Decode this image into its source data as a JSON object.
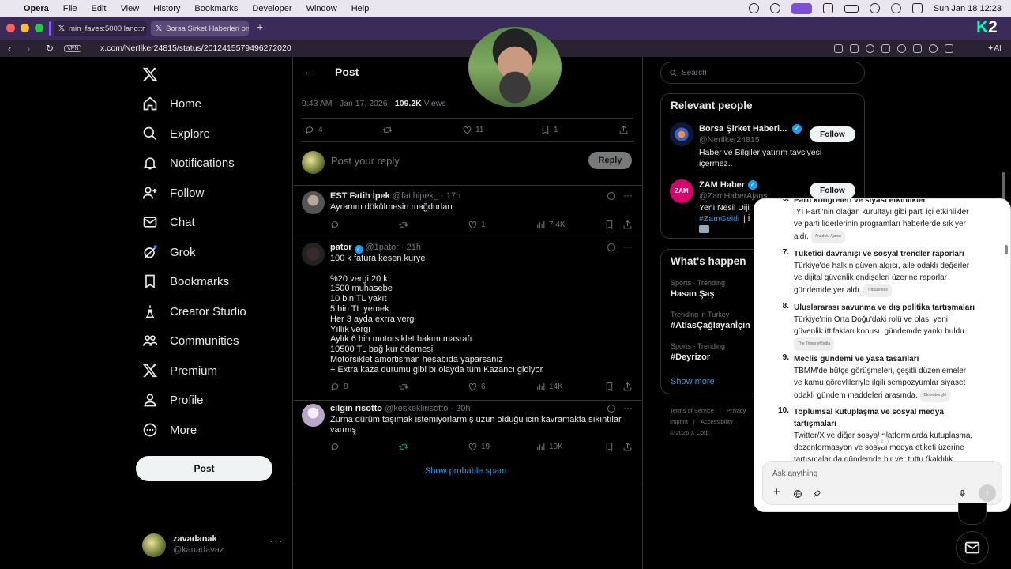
{
  "menubar": {
    "app": "Opera",
    "items": [
      "File",
      "Edit",
      "View",
      "History",
      "Bookmarks",
      "Developer",
      "Window",
      "Help"
    ],
    "datetime": "Sun Jan 18  12:23"
  },
  "browser": {
    "tabs": [
      {
        "title": "min_faves:5000 lang:tr"
      },
      {
        "title": "Borsa Şirket Haberleri on"
      }
    ],
    "url": "x.com/NerIlker24815/status/2012415579496272020",
    "vpn": "VPN",
    "ai_label": "AI"
  },
  "nav": {
    "items": [
      {
        "label": "Home",
        "icon": "home-icon"
      },
      {
        "label": "Explore",
        "icon": "search-icon"
      },
      {
        "label": "Notifications",
        "icon": "bell-icon"
      },
      {
        "label": "Follow",
        "icon": "person-add-icon"
      },
      {
        "label": "Chat",
        "icon": "mail-icon"
      },
      {
        "label": "Grok",
        "icon": "grok-icon"
      },
      {
        "label": "Bookmarks",
        "icon": "bookmark-icon"
      },
      {
        "label": "Creator Studio",
        "icon": "creator-icon"
      },
      {
        "label": "Communities",
        "icon": "communities-icon"
      },
      {
        "label": "Premium",
        "icon": "x-logo-icon"
      },
      {
        "label": "Profile",
        "icon": "person-icon"
      },
      {
        "label": "More",
        "icon": "more-circle-icon"
      }
    ],
    "post_button": "Post",
    "account": {
      "name": "zavadanak",
      "handle": "@kanadavaz"
    }
  },
  "post": {
    "header": "Post",
    "meta_time": "9:43 AM · Jan 17, 2026 · ",
    "views_count": "109.2K",
    "views_label": " Views",
    "replies": "4",
    "likes": "11",
    "bookmarks": "1",
    "reply_placeholder": "Post your reply",
    "reply_button": "Reply"
  },
  "replies": [
    {
      "name": "EST Fatih İpek",
      "handle": "@fatihipek_ · 17h",
      "text": "Ayranım dökülmesin mağdurları",
      "replies": "",
      "retweets": "",
      "likes": "1",
      "views": "7.4K"
    },
    {
      "name": "pator",
      "handle": "@1pator · 21h",
      "text": "100 k fatura kesen kurye\n\n%20 vergi 20 k\n1500 muhasebe\n10 bin TL yakıt\n5 bin TL yemek\nHer 3 ayda exrra vergi\nYıllık vergi\nAylık 6 bin motorsiklet bakım masrafı\n10500 TL bağ kur ödemesi\nMotorsiklet amortisman hesabıda yaparsanız\n+ Extra kaza durumu gibi bı olayda tüm Kazancı gidiyor",
      "replies": "8",
      "retweets": "",
      "likes": "6",
      "views": "14K"
    },
    {
      "name": "cilgin risotto",
      "handle": "@keskeklirisotto · 20h",
      "text": "Zurna dürüm taşımak istemiyorlarmış uzun olduğu icin kavramakta sıkıntılar\nvarmış",
      "replies": "",
      "retweets": "",
      "likes": "19",
      "views": "10K"
    }
  ],
  "show_spam": "Show probable spam",
  "right": {
    "search_placeholder": "Search",
    "relevant_title": "Relevant people",
    "people": [
      {
        "name": "Borsa Şirket Haberl...",
        "handle": "@NerIlker24815",
        "bio": "Haber ve Bilgiler yatırım tavsiyesi\niçermez..",
        "follow": "Follow"
      },
      {
        "name": "ZAM Haber",
        "handle": "@ZamHaberAjans",
        "bio": "Yeni Nesil Diji",
        "tag": "#ZamGeldi",
        "tag_suffix": " | İ",
        "avatar_text": "ZAM",
        "follow": "Follow"
      }
    ],
    "happening_title": "What's happen",
    "trends": [
      {
        "context": "Sports · Trending",
        "name": "Hasan Şaş"
      },
      {
        "context": "Trending in Turkey",
        "name": "#AtlasÇağlayanİçin"
      },
      {
        "context": "Sports · Trending",
        "name": "#Deyrizor"
      }
    ],
    "show_more": "Show more",
    "footer": [
      "Terms of Service",
      "Privacy",
      "Imprint",
      "Accessibility",
      "© 2026 X Corp."
    ]
  },
  "grok": {
    "items": [
      {
        "num": "6.",
        "title": "Parti kongreleri ve siyasi etkinlikler",
        "body": "İYİ Parti'nin olağan kurultayı gibi parti içi etkinlikler\nve parti liderlerinin programları haberlerde sık yer\naldı.",
        "source": "Anadolu Ajansı"
      },
      {
        "num": "7.",
        "title": "Tüketici davranışı ve sosyal trendler raporları",
        "body": "Türkiye'de halkın güven algısı, aile odaklı değerler\nve dijital güvenlik endişeleri üzerine raporlar\ngündemde yer aldı.",
        "source": "Tribusiness"
      },
      {
        "num": "8.",
        "title": "Uluslararası savunma ve dış politika tartışmaları",
        "body": "Türkiye'nin Orta Doğu'daki rolü ve olası yeni\ngüvenlik ittifakları konusu gündemde yankı buldu.",
        "source": "The Times of India"
      },
      {
        "num": "9.",
        "title": "Meclis gündemi ve yasa tasarıları",
        "body": "TBMM'de bütçe görüşmeleri, çeşitli düzenlemeler\nve kamu görevlileriyle ilgili sempozyumlar siyaset\nodaklı gündem maddeleri arasında.",
        "source": "Bloomberght"
      },
      {
        "num": "10.",
        "title": "Toplumsal kutuplaşma ve sosyal medya\ntartışmaları",
        "body": "Twitter/X ve diğer sosyal platformlarda kutuplaşma,\ndezenformasyon ve sosyal medya etiketi üzerine\ntartışmalar da gündemde bir yer tuttu (kaldılık",
        "source": ""
      }
    ],
    "input_placeholder": "Ask anything"
  },
  "colors": {
    "accent": "#1d9bf0",
    "retweet_green": "#00ba7c",
    "browser_tabbar": "#3b2b5a",
    "background": "#000000"
  }
}
